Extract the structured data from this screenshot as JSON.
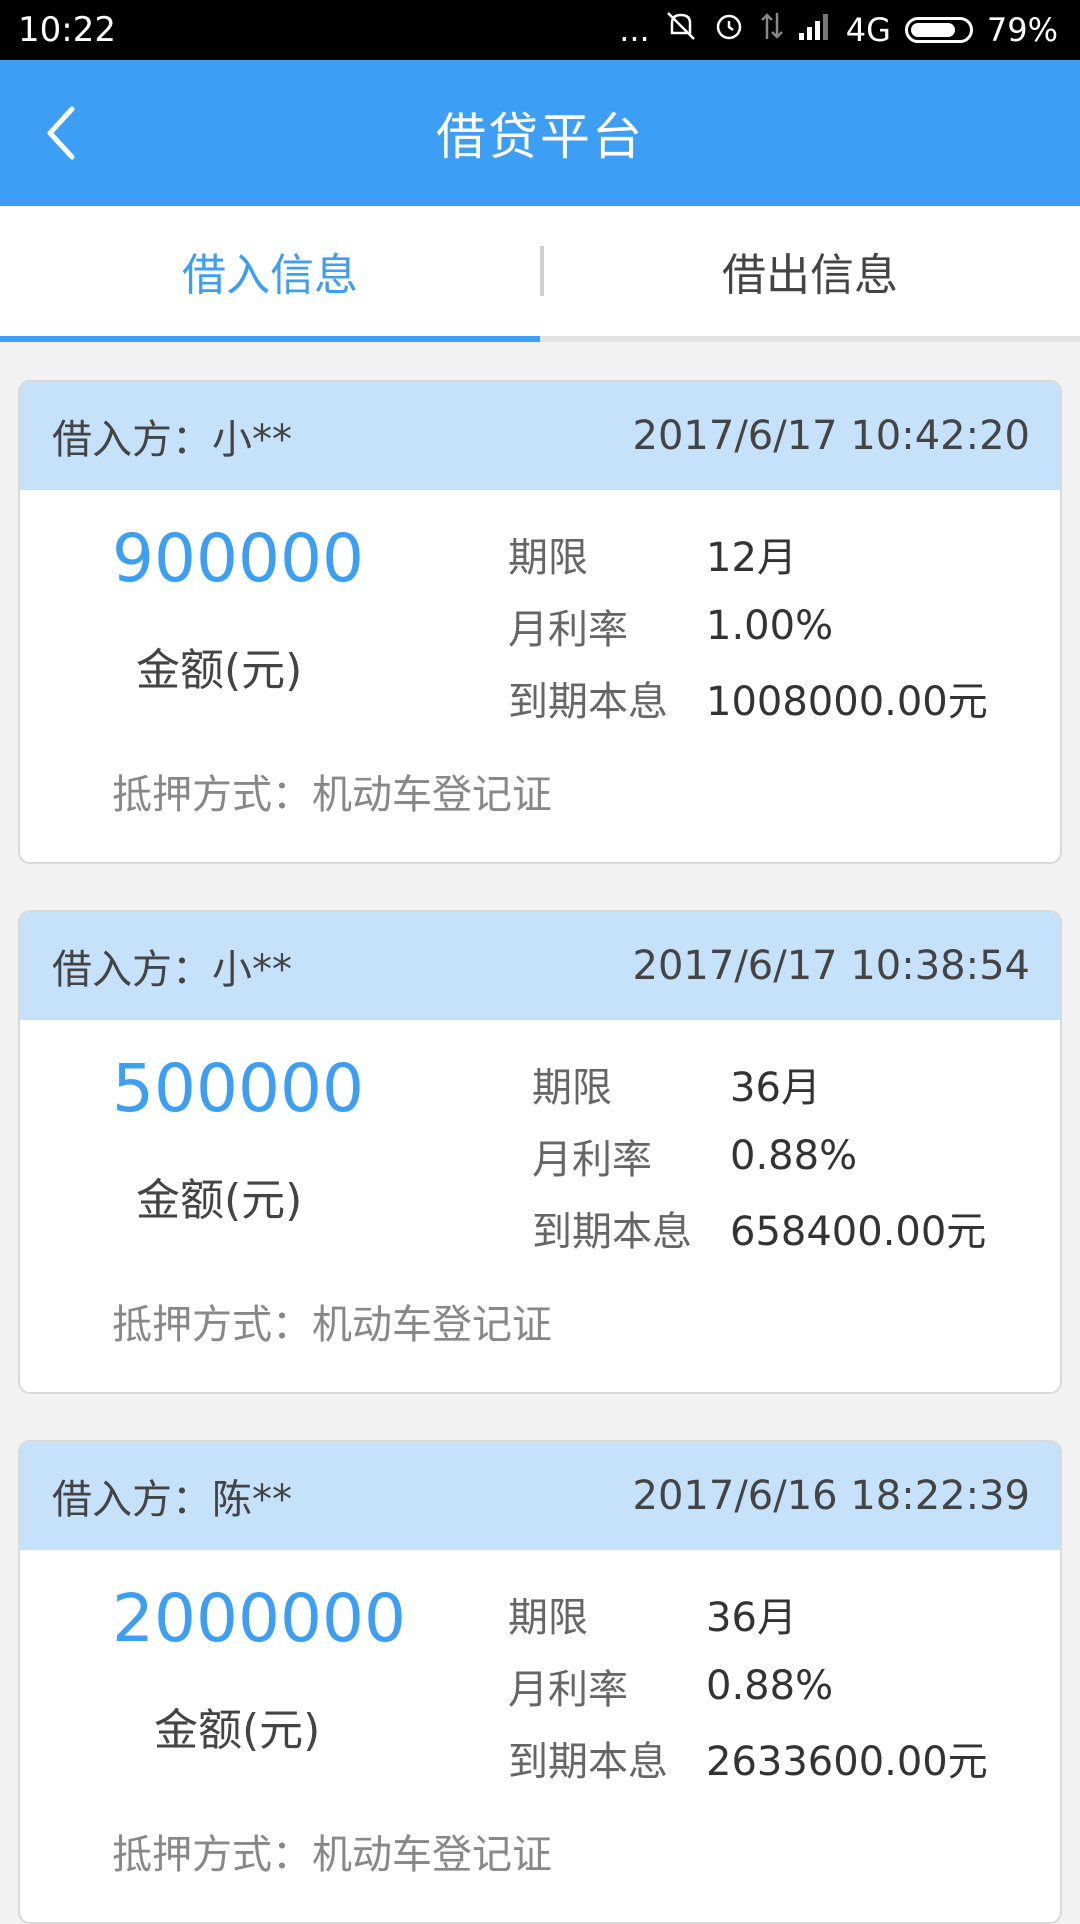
{
  "status_bar": {
    "time": "10:22",
    "dots": "...",
    "network": "4G",
    "battery_percent": "79%",
    "battery_level": 0.79,
    "icons": [
      "mute-icon",
      "alarm-icon",
      "data-arrows-icon",
      "signal-icon"
    ]
  },
  "header": {
    "title": "借贷平台"
  },
  "tabs": [
    {
      "label": "借入信息",
      "active": true
    },
    {
      "label": "借出信息",
      "active": false
    }
  ],
  "colors": {
    "accent": "#3d9ef5",
    "card_header": "#c6e1fa"
  },
  "loans": [
    {
      "borrower": "借入方：小**",
      "datetime": "2017/6/17 10:42:20",
      "amount": "900000",
      "amount_label": "金额(元)",
      "term_label": "期限",
      "term": "12月",
      "rate_label": "月利率",
      "rate": "1.00%",
      "total_label": "到期本息",
      "total": "1008000.00元",
      "collateral": "抵押方式：机动车登记证"
    },
    {
      "borrower": "借入方：小**",
      "datetime": "2017/6/17 10:38:54",
      "amount": "500000",
      "amount_label": "金额(元)",
      "term_label": "期限",
      "term": "36月",
      "rate_label": "月利率",
      "rate": "0.88%",
      "total_label": "到期本息",
      "total": "658400.00元",
      "collateral": "抵押方式：机动车登记证"
    },
    {
      "borrower": "借入方：陈**",
      "datetime": "2017/6/16 18:22:39",
      "amount": "2000000",
      "amount_label": "金额(元)",
      "term_label": "期限",
      "term": "36月",
      "rate_label": "月利率",
      "rate": "0.88%",
      "total_label": "到期本息",
      "total": "2633600.00元",
      "collateral": "抵押方式：机动车登记证"
    }
  ]
}
